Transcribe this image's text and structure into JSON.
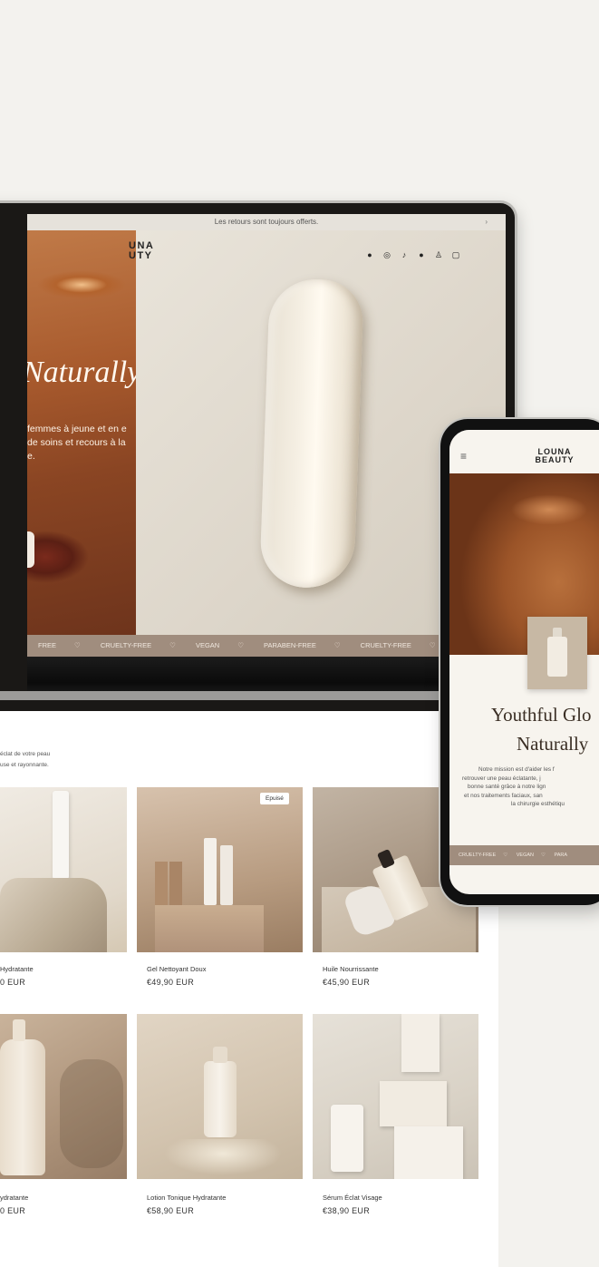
{
  "laptop": {
    "announcement": "Les retours sont toujours offerts.",
    "brand_line1": "UNA",
    "brand_line2": "UTY",
    "hero_title": "Naturally",
    "hero_text": "femmes à jeune et en e de soins et recours à la e.",
    "header_icons": [
      "facebook-icon",
      "instagram-icon",
      "tiktok-icon",
      "pinterest-icon",
      "account-icon",
      "cart-icon"
    ],
    "marquee": [
      "FREE",
      "CRUELTY-FREE",
      "VEGAN",
      "PARABEN-FREE",
      "CRUELTY-FREE"
    ]
  },
  "site": {
    "intro_line1": "éclat de votre peau",
    "intro_line2": "use et rayonnante.",
    "products": [
      {
        "name": "Hydratante",
        "price": "0 EUR",
        "badge": ""
      },
      {
        "name": "Gel Nettoyant Doux",
        "price": "€49,90 EUR",
        "badge": "Epuisé"
      },
      {
        "name": "Huile Nourrissante",
        "price": "€45,90 EUR",
        "badge": ""
      },
      {
        "name": "ydratante",
        "price": "0 EUR",
        "badge": ""
      },
      {
        "name": "Lotion Tonique Hydratante",
        "price": "€58,90 EUR",
        "badge": ""
      },
      {
        "name": "Sérum Éclat Visage",
        "price": "€38,90 EUR",
        "badge": ""
      }
    ]
  },
  "phone": {
    "brand_line1": "LOUNA",
    "brand_line2": "BEAUTY",
    "title_line1": "Youthful Glo",
    "title_line2": "Naturally",
    "text_lines": [
      "Notre mission est d'aider les f",
      "retrouver une peau éclatante, j",
      "bonne santé grâce à notre lign",
      "et nos traitements faciaux, san",
      "la chirurgie esthétiqu"
    ],
    "marquee": [
      "CRUELTY-FREE",
      "VEGAN",
      "PARA"
    ]
  },
  "colors": {
    "background": "#f3f2ee",
    "marquee_band": "#a08d7e",
    "hero_face": "#a85a2d"
  }
}
